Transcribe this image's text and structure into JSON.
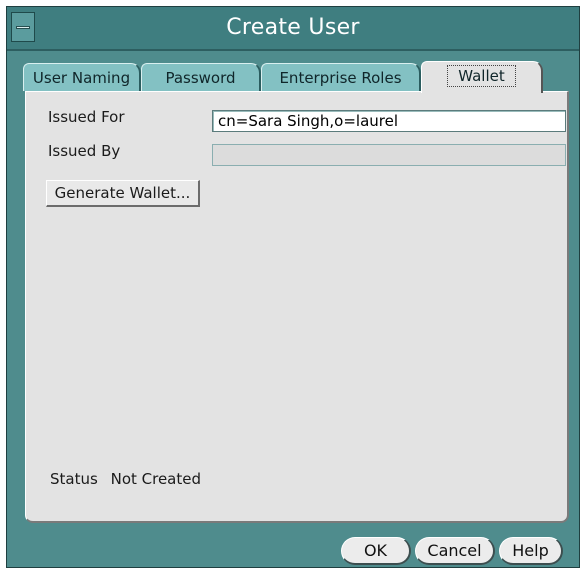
{
  "window": {
    "title": "Create User"
  },
  "tabs": [
    {
      "label": "User Naming"
    },
    {
      "label": "Password"
    },
    {
      "label": "Enterprise Roles"
    },
    {
      "label": "Wallet",
      "active": true
    }
  ],
  "form": {
    "issued_for_label": "Issued For",
    "issued_for_value": "cn=Sara Singh,o=laurel",
    "issued_by_label": "Issued By",
    "issued_by_value": "",
    "generate_button": "Generate Wallet..."
  },
  "status": {
    "label": "Status",
    "value": "Not Created"
  },
  "buttons": {
    "ok": "OK",
    "cancel": "Cancel",
    "help": "Help"
  },
  "colors": {
    "frame": "#4f8c8d",
    "title_bar": "#3f7e80",
    "tab_inactive": "#83c1c3",
    "panel": "#e3e3e3"
  }
}
